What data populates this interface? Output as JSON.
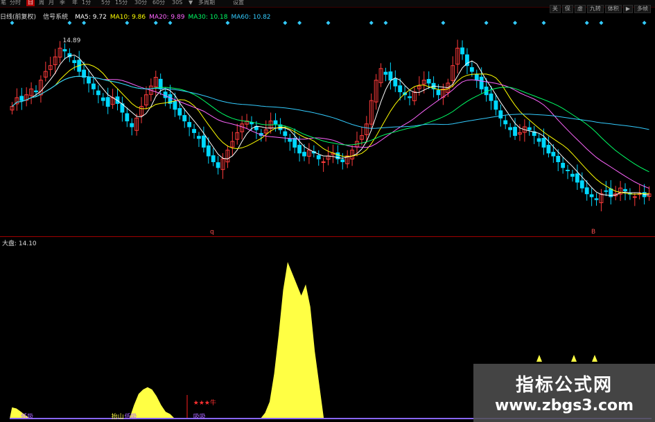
{
  "toolbar": {
    "tabs": [
      {
        "label": "笔",
        "active": false
      },
      {
        "label": "分时",
        "active": false
      },
      {
        "label": "日",
        "active": true
      },
      {
        "label": "周",
        "active": false
      },
      {
        "label": "月",
        "active": false
      },
      {
        "label": "季",
        "active": false
      },
      {
        "label": "年",
        "active": false
      },
      {
        "label": "1分",
        "active": false
      },
      {
        "label": "5分",
        "active": false
      },
      {
        "label": "15分",
        "active": false
      },
      {
        "label": "30分",
        "active": false
      },
      {
        "label": "60分",
        "active": false
      },
      {
        "label": "30S",
        "active": false
      },
      {
        "label": "▼",
        "active": false
      },
      {
        "label": "多周期",
        "active": false
      },
      {
        "label": "设置",
        "active": false
      }
    ],
    "right": [
      "关",
      "保",
      "虚",
      "九转",
      "体积",
      "▶",
      "多帧"
    ]
  },
  "info": {
    "mode": "日线(前复权)",
    "name": "信号系统",
    "ma": [
      {
        "label": "MA5: 9.72",
        "color": "#ffffff"
      },
      {
        "label": "MA10: 9.86",
        "color": "#ffff00"
      },
      {
        "label": "MA20: 9.89",
        "color": "#ff66ff"
      },
      {
        "label": "MA30: 10.18",
        "color": "#00ff66"
      },
      {
        "label": "MA60: 10.82",
        "color": "#33ccff"
      }
    ]
  },
  "main_chart": {
    "y_range": [
      8.5,
      15.3
    ],
    "high_label": "14.89",
    "marker_label": "q",
    "marker2_label": "B",
    "colors": {
      "up": "#ff3b3b",
      "down": "#00d8ff",
      "diamond": "#33ccff",
      "ma5": "#ffffff",
      "ma10": "#ffff00",
      "ma20": "#ff66ff",
      "ma30": "#00ff66",
      "ma60": "#33ccff"
    },
    "closes": [
      12.6,
      12.9,
      12.8,
      13.0,
      13.2,
      13.1,
      13.5,
      13.8,
      14.0,
      14.3,
      14.6,
      14.5,
      14.3,
      14.1,
      13.8,
      13.6,
      13.4,
      13.2,
      13.0,
      12.8,
      12.6,
      12.9,
      12.7,
      12.4,
      12.1,
      11.9,
      12.2,
      12.6,
      13.0,
      13.3,
      13.6,
      13.2,
      12.9,
      12.7,
      12.5,
      12.3,
      12.1,
      11.9,
      11.7,
      11.5,
      11.2,
      10.9,
      10.7,
      10.5,
      10.8,
      11.1,
      11.4,
      11.7,
      12.0,
      12.1,
      12.0,
      11.8,
      11.6,
      11.8,
      12.1,
      12.0,
      11.8,
      11.6,
      11.4,
      11.2,
      11.0,
      10.9,
      11.1,
      11.0,
      10.8,
      10.7,
      10.9,
      11.0,
      10.8,
      10.7,
      10.9,
      11.1,
      11.4,
      11.6,
      12.0,
      12.8,
      13.5,
      13.9,
      13.7,
      13.5,
      13.3,
      13.1,
      13.0,
      12.9,
      13.1,
      13.3,
      13.5,
      13.4,
      13.2,
      13.0,
      13.2,
      13.4,
      14.0,
      14.6,
      14.4,
      14.0,
      13.8,
      13.5,
      13.2,
      13.0,
      12.8,
      12.5,
      12.2,
      12.0,
      11.8,
      11.6,
      11.7,
      11.9,
      11.8,
      11.6,
      11.4,
      11.2,
      11.0,
      10.9,
      10.7,
      10.5,
      10.4,
      10.2,
      10.0,
      9.8,
      9.6,
      9.5,
      9.4,
      9.6,
      9.7,
      9.5,
      9.6,
      9.8,
      9.7,
      9.6,
      9.5,
      9.6,
      9.5,
      9.6
    ]
  },
  "sub_chart": {
    "label": "大盘: 14.10",
    "y_range": [
      0,
      15
    ],
    "color": "#ffff44",
    "bottom_color": "#8866ff",
    "values": [
      1.0,
      0.9,
      0.6,
      0.3,
      0,
      0,
      0,
      0,
      0,
      0,
      0,
      0,
      0,
      0,
      0,
      0,
      0,
      0,
      0,
      0,
      0,
      0,
      0,
      0,
      0,
      0,
      0,
      1.2,
      2.2,
      2.6,
      2.8,
      2.6,
      2.0,
      1.2,
      0.6,
      0.4,
      0,
      0,
      0,
      0,
      0,
      0,
      0,
      0,
      0,
      0,
      0,
      0,
      0,
      0,
      0,
      0,
      0,
      0,
      0,
      0,
      0.5,
      1.5,
      4.0,
      7.5,
      11.5,
      14.0,
      13.0,
      12.0,
      11.0,
      12.0,
      10.0,
      6.0,
      3.0,
      0,
      0,
      0,
      0,
      0,
      0,
      0,
      0,
      0,
      0,
      0,
      0,
      0,
      0,
      0,
      0,
      0,
      0,
      0,
      0,
      0,
      0,
      0,
      0,
      0,
      0,
      0,
      0,
      0,
      0,
      0,
      0,
      0,
      0,
      0,
      0,
      0,
      0,
      0,
      0,
      0,
      0,
      0,
      0,
      0,
      0,
      0,
      0,
      0,
      0,
      0,
      0,
      0,
      0,
      0,
      0,
      0,
      0,
      0,
      0,
      0,
      0,
      0,
      0,
      0,
      0,
      0,
      0,
      0,
      0,
      0,
      0,
      0
    ],
    "bottom_labels": [
      {
        "text": "低吸",
        "color": "#aa66ff",
        "x_fraction": 0.032
      },
      {
        "text": "抬山",
        "color": "#ffff44",
        "x_fraction": 0.17
      },
      {
        "text": "低吸",
        "color": "#aa66ff",
        "x_fraction": 0.19
      },
      {
        "text": "★★★牛",
        "color": "#ff3030",
        "x_fraction": 0.295
      },
      {
        "text": "吸吸",
        "color": "#aa66ff",
        "x_fraction": 0.295
      }
    ]
  },
  "watermark": {
    "title": "指标公式网",
    "url": "www.zbgs3.com"
  }
}
